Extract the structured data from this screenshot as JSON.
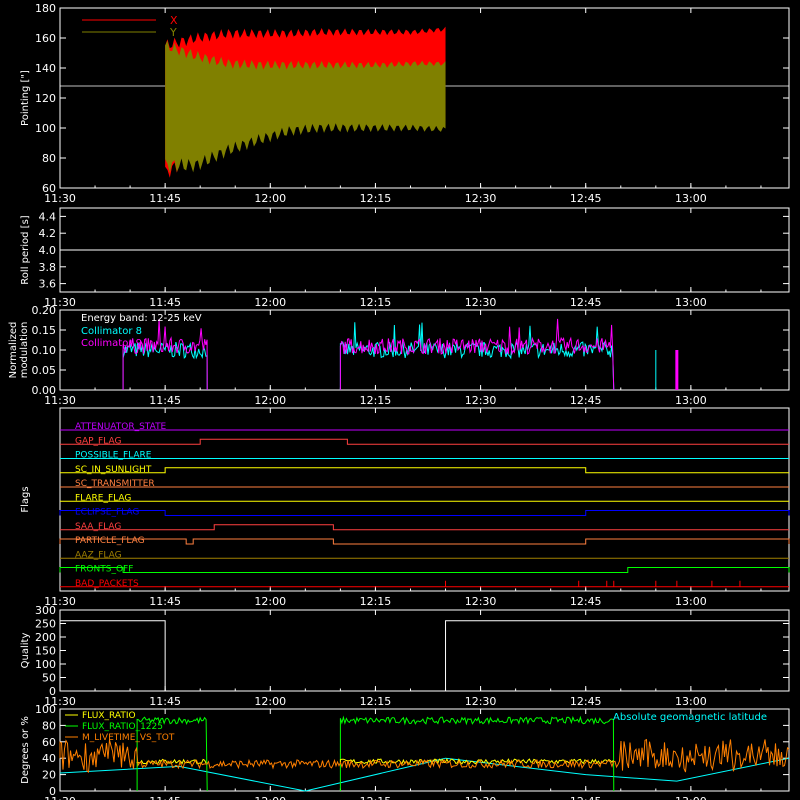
{
  "chart_data": [
    {
      "type": "area",
      "ylabel": "Pointing [\"]",
      "ylim": [
        60,
        180
      ],
      "yticks": [
        60,
        80,
        100,
        120,
        140,
        160,
        180
      ],
      "xticks": [
        "11:30",
        "11:45",
        "12:00",
        "12:15",
        "12:30",
        "12:45",
        "13:00"
      ],
      "reference_line": 128,
      "series": [
        {
          "name": "X",
          "color": "#ff0000",
          "x": [
            "11:45",
            "11:47",
            "11:50",
            "11:55",
            "12:00",
            "12:05",
            "12:10",
            "12:15",
            "12:20",
            "12:25"
          ],
          "upper": [
            155,
            160,
            163,
            163,
            163,
            164,
            164,
            164,
            164,
            166
          ],
          "lower": [
            70,
            82,
            95,
            100,
            104,
            106,
            106,
            107,
            106,
            104
          ]
        },
        {
          "name": "Y",
          "color": "#808000",
          "x": [
            "11:45",
            "11:47",
            "11:50",
            "11:55",
            "12:00",
            "12:05",
            "12:10",
            "12:15",
            "12:20",
            "12:25"
          ],
          "upper": [
            155,
            148,
            143,
            142,
            142,
            142,
            142,
            142,
            143,
            143
          ],
          "lower": [
            75,
            75,
            85,
            92,
            98,
            100,
            100,
            100,
            100,
            99
          ]
        }
      ]
    },
    {
      "type": "line",
      "ylabel": "Roll period [s]",
      "ylim": [
        3.5,
        4.5
      ],
      "yticks": [
        "3.6",
        "3.8",
        "4.0",
        "4.2",
        "4.4"
      ],
      "xticks": [
        "11:30",
        "11:45",
        "12:00",
        "12:15",
        "12:30",
        "12:45",
        "13:00"
      ],
      "series": [
        {
          "color": "#ffffff",
          "x": [
            "11:30",
            "13:14"
          ],
          "y": [
            4.0,
            4.0
          ]
        }
      ]
    },
    {
      "type": "line",
      "ylabel": "Normalized modulation",
      "ylim": [
        0,
        0.2
      ],
      "yticks": [
        "0.00",
        "0.05",
        "0.10",
        "0.15",
        "0.20"
      ],
      "xticks": [
        "11:30",
        "11:45",
        "12:00",
        "12:15",
        "12:30",
        "12:45",
        "13:00"
      ],
      "annotation": "Energy band: 12-25 keV",
      "series": [
        {
          "name": "Collimator 8",
          "color": "#00ffff",
          "segments": [
            [
              "11:39",
              "11:51"
            ],
            [
              "12:10",
              "12:49"
            ]
          ],
          "level": 0.1
        },
        {
          "name": "Collimator 9",
          "color": "#ff00ff",
          "segments": [
            [
              "11:39",
              "11:51"
            ],
            [
              "12:10",
              "12:49"
            ]
          ],
          "level": 0.11
        }
      ]
    },
    {
      "type": "line",
      "ylabel": "Flags",
      "xticks": [
        "11:30",
        "11:45",
        "12:00",
        "12:15",
        "12:30",
        "12:45",
        "13:00"
      ],
      "flags": [
        {
          "name": "ATTENUATOR_STATE",
          "color": "#c000ff",
          "on": []
        },
        {
          "name": "GAP_FLAG",
          "color": "#ff4040",
          "on": [
            [
              "11:50",
              "12:11"
            ]
          ]
        },
        {
          "name": "POSSIBLE_FLARE",
          "color": "#00ffff",
          "on": []
        },
        {
          "name": "SC_IN_SUNLIGHT",
          "color": "#ffff00",
          "on": [
            [
              "11:45",
              "12:45"
            ]
          ]
        },
        {
          "name": "SC_TRANSMITTER",
          "color": "#ff8040",
          "on": []
        },
        {
          "name": "FLARE_FLAG",
          "color": "#ffff00",
          "on": []
        },
        {
          "name": "ECLIPSE_FLAG",
          "color": "#0000ff",
          "on": [
            [
              "11:30",
              "11:45"
            ],
            [
              "12:45",
              "13:14"
            ]
          ]
        },
        {
          "name": "SAA_FLAG",
          "color": "#ff4040",
          "on": [
            [
              "11:52",
              "12:09"
            ]
          ]
        },
        {
          "name": "PARTICLE_FLAG",
          "color": "#ff8040",
          "on": [
            [
              "11:30",
              "11:48"
            ],
            [
              "11:49",
              "12:09"
            ],
            [
              "12:45",
              "13:14"
            ]
          ]
        },
        {
          "name": "AAZ_FLAG",
          "color": "#a08000",
          "on": []
        },
        {
          "name": "FRONTS_OFF",
          "color": "#00ff00",
          "on": [
            [
              "11:30",
              "11:39"
            ],
            [
              "12:51",
              "13:14"
            ]
          ]
        },
        {
          "name": "BAD_PACKETS",
          "color": "#ff0000",
          "on": []
        }
      ]
    },
    {
      "type": "line",
      "ylabel": "Quality",
      "ylim": [
        0,
        300
      ],
      "yticks": [
        "0",
        "50",
        "100",
        "150",
        "200",
        "250",
        "300"
      ],
      "xticks": [
        "11:30",
        "11:45",
        "12:00",
        "12:15",
        "12:30",
        "12:45",
        "13:00"
      ],
      "series": [
        {
          "color": "#ffffff",
          "x": [
            "11:30",
            "11:45",
            "11:45",
            "12:25",
            "12:25",
            "13:14"
          ],
          "y": [
            260,
            260,
            0,
            0,
            260,
            260
          ]
        }
      ]
    },
    {
      "type": "line",
      "ylabel": "Degrees or %",
      "ylim": [
        0,
        100
      ],
      "yticks": [
        "0",
        "20",
        "40",
        "60",
        "80",
        "100"
      ],
      "xticks": [
        "11:30",
        "11:45",
        "12:00",
        "12:15",
        "12:30",
        "12:45",
        "13:00"
      ],
      "legend": [
        {
          "name": "FLUX_RATIO",
          "color": "#ffff00"
        },
        {
          "name": "FLUX_RATIO_1225",
          "color": "#00ff00"
        },
        {
          "name": "M_LIVETIME_VS_TOT",
          "color": "#ff8000"
        }
      ],
      "annotation": {
        "text": "Absolute geomagnetic latitude",
        "color": "#00ffff"
      }
    }
  ]
}
